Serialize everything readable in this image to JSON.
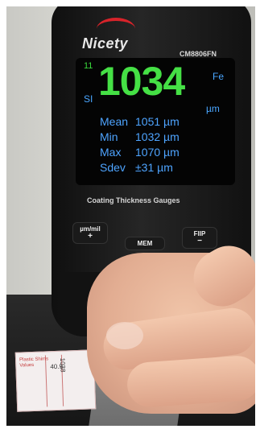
{
  "device": {
    "brand": "Nicety",
    "model": "CM8806FN",
    "caption": "Coating Thickness Gauges"
  },
  "display": {
    "index": "11",
    "mode": "SI",
    "reading": "1034",
    "material": "Fe",
    "unit": "µm",
    "stats": [
      {
        "label": "Mean",
        "value": "1051 µm"
      },
      {
        "label": "Min",
        "value": "1032 µm"
      },
      {
        "label": "Max",
        "value": "1070 µm"
      },
      {
        "label": "Sdev",
        "value": "±31 µm"
      }
    ]
  },
  "buttons": {
    "unit": {
      "label": "µm/mil",
      "symbol": "+"
    },
    "mem": {
      "label": "MEM"
    },
    "flip": {
      "label": "FlIP",
      "symbol": "−"
    }
  },
  "calibration_card": {
    "header": "Plastic Shims Values",
    "value1": "40.9",
    "value2": "1038"
  }
}
